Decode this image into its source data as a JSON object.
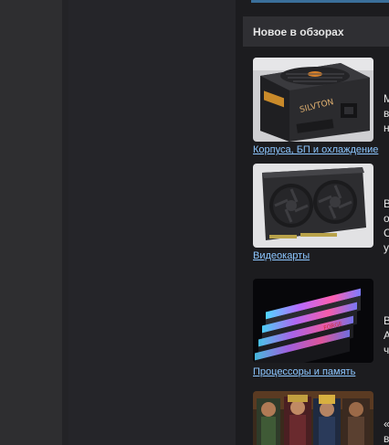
{
  "sidebar": {
    "title": "Новое в обзорах",
    "reviews": [
      {
        "category": "Корпуса, БП и охлаждение",
        "image": "power-supply-image",
        "text_fragments": [
          "М",
          "в",
          "н"
        ]
      },
      {
        "category": "Видеокарты",
        "image": "graphics-card-image",
        "text_fragments": [
          "В",
          "о",
          "С",
          "у"
        ]
      },
      {
        "category": "Процессоры и память",
        "image": "ram-modules-image",
        "text_fragments": [
          "В",
          "А",
          "ч"
        ]
      },
      {
        "category": "",
        "image": "game-characters-image",
        "text_fragments": [
          "«",
          "в"
        ]
      }
    ]
  }
}
